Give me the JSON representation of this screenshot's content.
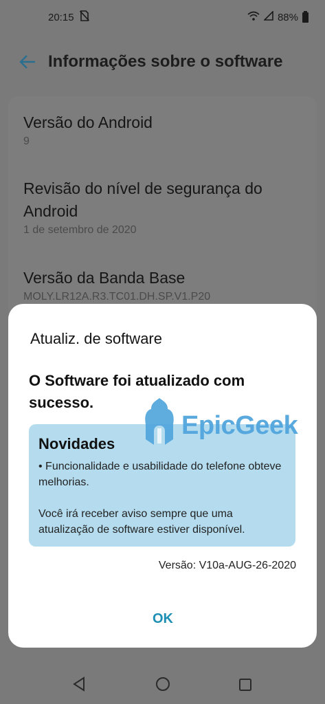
{
  "status_bar": {
    "time": "20:15",
    "battery": "88%",
    "icons": [
      "no-sim-icon",
      "wifi-icon",
      "signal-icon",
      "battery-icon"
    ]
  },
  "app_bar": {
    "title": "Informações sobre o software"
  },
  "info_list": [
    {
      "title": "Versão do Android",
      "value": "9"
    },
    {
      "title": "Revisão do nível de segurança do Android",
      "value": "1 de setembro de 2020"
    },
    {
      "title": "Versão da Banda Base",
      "value": "MOLY.LR12A.R3.TC01.DH.SP.V1.P20"
    }
  ],
  "dialog": {
    "title": "Atualiz. de software",
    "message": "O Software foi atualizado com sucesso.",
    "whats_new": {
      "title": "Novidades",
      "line1": "• Funcionalidade e usabilidade do telefone obteve melhorias.",
      "line2": "Você irá receber aviso sempre que uma atualização de software estiver disponível."
    },
    "version": "Versão: V10a-AUG-26-2020",
    "ok_label": "OK"
  },
  "watermark": {
    "text": "EpicGeek"
  },
  "colors": {
    "accent": "#1d8fb5",
    "whats_new_bg": "#b4dcee",
    "watermark": "#4ea3dc",
    "dim_background": "#7a7a7a"
  }
}
